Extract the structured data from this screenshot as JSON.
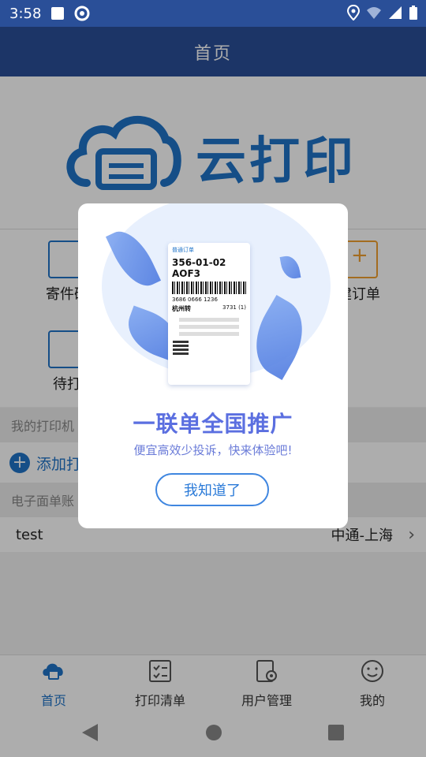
{
  "status_bar": {
    "time": "3:58"
  },
  "app_bar": {
    "title": "首页"
  },
  "logo": {
    "text": "云打印"
  },
  "grid": {
    "items": [
      {
        "label": "寄件码"
      },
      {
        "label": "建订单"
      },
      {
        "label": "待打"
      }
    ]
  },
  "sections": {
    "printers_header": "我的打印机",
    "add_printer_label": "添加打",
    "waybill_header": "电子面单账"
  },
  "list": {
    "rows": [
      {
        "name": "test",
        "value": "中通-上海"
      }
    ]
  },
  "tabs": [
    {
      "label": "首页",
      "active": true
    },
    {
      "label": "打印清单",
      "active": false
    },
    {
      "label": "用户管理",
      "active": false
    },
    {
      "label": "我的",
      "active": false
    }
  ],
  "dialog": {
    "ticket": {
      "header": "普通订单",
      "code": "356-01-02 AOF3",
      "numbers": "3686 0666 1236",
      "city": "杭州转",
      "side_code": "3731 (1)"
    },
    "title": "一联单全国推广",
    "subtitle": "便宜高效少投诉，快来体验吧!",
    "button_label": "我知道了"
  },
  "colors": {
    "primary": "#2a4f98",
    "accent": "#1f73c8"
  }
}
